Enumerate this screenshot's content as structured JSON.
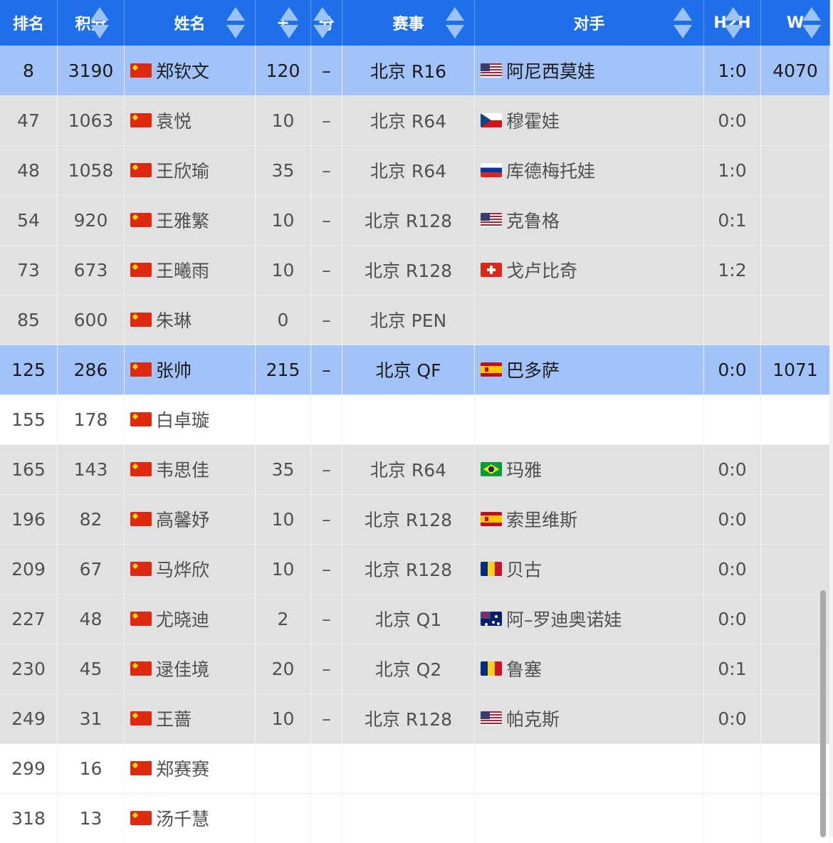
{
  "columns": [
    {
      "key": "rank",
      "label": "排名",
      "sortable": false
    },
    {
      "key": "points",
      "label": "积分",
      "sortable": true
    },
    {
      "key": "name",
      "label": "姓名",
      "sortable": true
    },
    {
      "key": "plus",
      "label": "+",
      "sortable": true
    },
    {
      "key": "minus",
      "label": "分",
      "sortable": true
    },
    {
      "key": "event",
      "label": "赛事",
      "sortable": true
    },
    {
      "key": "opponent",
      "label": "对手",
      "sortable": true
    },
    {
      "key": "h2h",
      "label": "H2H",
      "sortable": true
    },
    {
      "key": "w",
      "label": "W",
      "sortable": true
    }
  ],
  "rows": [
    {
      "style": "hl",
      "rank": "8",
      "points": "3190",
      "flag": "cn-flag-icon",
      "name": "郑钦文",
      "plus": "120",
      "minus": "–",
      "event": "北京 R16",
      "opp_flag": "us-flag-icon",
      "opponent": "阿尼西莫娃",
      "h2h": "1:0",
      "w": "4070"
    },
    {
      "style": "gr",
      "rank": "47",
      "points": "1063",
      "flag": "cn-flag-icon",
      "name": "袁悦",
      "plus": "10",
      "minus": "–",
      "event": "北京 R64",
      "opp_flag": "cz-flag-icon",
      "opponent": "穆霍娃",
      "h2h": "0:0",
      "w": ""
    },
    {
      "style": "gr",
      "rank": "48",
      "points": "1058",
      "flag": "cn-flag-icon",
      "name": "王欣瑜",
      "plus": "35",
      "minus": "–",
      "event": "北京 R64",
      "opp_flag": "ru-flag-icon",
      "opponent": "库德梅托娃",
      "h2h": "1:0",
      "w": ""
    },
    {
      "style": "gr",
      "rank": "54",
      "points": "920",
      "flag": "cn-flag-icon",
      "name": "王雅繁",
      "plus": "10",
      "minus": "–",
      "event": "北京 R128",
      "opp_flag": "us-flag-icon",
      "opponent": "克鲁格",
      "h2h": "0:1",
      "w": ""
    },
    {
      "style": "gr",
      "rank": "73",
      "points": "673",
      "flag": "cn-flag-icon",
      "name": "王曦雨",
      "plus": "10",
      "minus": "–",
      "event": "北京 R128",
      "opp_flag": "ch-flag-icon",
      "opponent": "戈卢比奇",
      "h2h": "1:2",
      "w": ""
    },
    {
      "style": "gr",
      "rank": "85",
      "points": "600",
      "flag": "cn-flag-icon",
      "name": "朱琳",
      "plus": "0",
      "minus": "–",
      "event": "北京 PEN",
      "opp_flag": "",
      "opponent": "",
      "h2h": "",
      "w": ""
    },
    {
      "style": "hl",
      "rank": "125",
      "points": "286",
      "flag": "cn-flag-icon",
      "name": "张帅",
      "plus": "215",
      "minus": "–",
      "event": "北京 QF",
      "opp_flag": "es-flag-icon",
      "opponent": "巴多萨",
      "h2h": "0:0",
      "w": "1071"
    },
    {
      "style": "wh",
      "rank": "155",
      "points": "178",
      "flag": "cn-flag-icon",
      "name": "白卓璇",
      "plus": "",
      "minus": "",
      "event": "",
      "opp_flag": "",
      "opponent": "",
      "h2h": "",
      "w": ""
    },
    {
      "style": "gr",
      "rank": "165",
      "points": "143",
      "flag": "cn-flag-icon",
      "name": "韦思佳",
      "plus": "35",
      "minus": "–",
      "event": "北京 R64",
      "opp_flag": "br-flag-icon",
      "opponent": "玛雅",
      "h2h": "0:0",
      "w": ""
    },
    {
      "style": "gr",
      "rank": "196",
      "points": "82",
      "flag": "cn-flag-icon",
      "name": "高馨妤",
      "plus": "10",
      "minus": "–",
      "event": "北京 R128",
      "opp_flag": "es-flag-icon",
      "opponent": "索里维斯",
      "h2h": "0:0",
      "w": ""
    },
    {
      "style": "gr",
      "rank": "209",
      "points": "67",
      "flag": "cn-flag-icon",
      "name": "马烨欣",
      "plus": "10",
      "minus": "–",
      "event": "北京 R128",
      "opp_flag": "ro-flag-icon",
      "opponent": "贝古",
      "h2h": "0:0",
      "w": ""
    },
    {
      "style": "gr",
      "rank": "227",
      "points": "48",
      "flag": "cn-flag-icon",
      "name": "尤晓迪",
      "plus": "2",
      "minus": "–",
      "event": "北京 Q1",
      "opp_flag": "au-flag-icon",
      "opponent": "阿–罗迪奥诺娃",
      "h2h": "0:0",
      "w": ""
    },
    {
      "style": "gr",
      "rank": "230",
      "points": "45",
      "flag": "cn-flag-icon",
      "name": "逯佳境",
      "plus": "20",
      "minus": "–",
      "event": "北京 Q2",
      "opp_flag": "ro-flag-icon",
      "opponent": "鲁塞",
      "h2h": "0:1",
      "w": ""
    },
    {
      "style": "gr",
      "rank": "249",
      "points": "31",
      "flag": "cn-flag-icon",
      "name": "王蔷",
      "plus": "10",
      "minus": "–",
      "event": "北京 R128",
      "opp_flag": "us-flag-icon",
      "opponent": "帕克斯",
      "h2h": "0:0",
      "w": ""
    },
    {
      "style": "wh",
      "rank": "299",
      "points": "16",
      "flag": "cn-flag-icon",
      "name": "郑赛赛",
      "plus": "",
      "minus": "",
      "event": "",
      "opp_flag": "",
      "opponent": "",
      "h2h": "",
      "w": ""
    },
    {
      "style": "wh",
      "rank": "318",
      "points": "13",
      "flag": "cn-flag-icon",
      "name": "汤千慧",
      "plus": "",
      "minus": "",
      "event": "",
      "opp_flag": "",
      "opponent": "",
      "h2h": "",
      "w": ""
    }
  ],
  "colors": {
    "header": "#1f6fea",
    "highlight": "#a2c3fa",
    "gray": "#e1e1e1",
    "white": "#ffffff"
  }
}
